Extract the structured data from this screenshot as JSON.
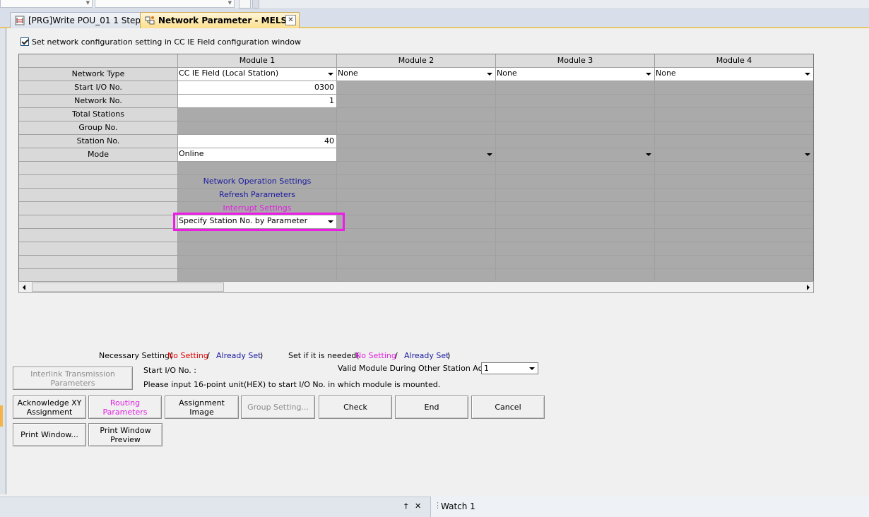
{
  "tabs": [
    {
      "label": "[PRG]Write POU_01 1 Step",
      "active": false
    },
    {
      "label": "Network Parameter - MELS...",
      "active": true
    }
  ],
  "sync_checkbox": {
    "label": "Set network configuration setting in CC IE Field configuration window",
    "checked": true
  },
  "grid": {
    "columns": [
      "Module 1",
      "Module 2",
      "Module 3",
      "Module 4"
    ],
    "row_labels": [
      "Network Type",
      "Start I/O No.",
      "Network No.",
      "Total Stations",
      "Group No.",
      "Station No.",
      "Mode"
    ],
    "network_type": [
      "CC IE Field (Local Station)",
      "None",
      "None",
      "None"
    ],
    "start_io": "0300",
    "network_no": "1",
    "station_no": "40",
    "mode": "Online",
    "links": {
      "network_operation": "Network Operation Settings",
      "refresh": "Refresh Parameters",
      "interrupt": "Interrupt Settings"
    },
    "station_spec": "Specify Station No. by Parameter"
  },
  "legend": {
    "necessary_label": "Necessary Setting(",
    "optional_label": "Set if it is needed(",
    "no_setting": "No Setting",
    "slash": "/",
    "already_set": "Already Set",
    "close_paren": ")"
  },
  "info": {
    "start_io_label": "Start I/O No. :",
    "hint": "Please input 16-point unit(HEX) to start I/O No. in which module is mounted.",
    "valid_module_label": "Valid Module During Other Station Access",
    "valid_module_value": "1"
  },
  "buttons": {
    "interlink": "Interlink Transmission Parameters",
    "ack_xy": "Acknowledge XY Assignment",
    "routing": "Routing Parameters",
    "assignment_image": "Assignment Image",
    "group_setting": "Group Setting...",
    "check": "Check",
    "end": "End",
    "cancel": "Cancel",
    "print_window": "Print Window...",
    "print_preview": "Print Window Preview"
  },
  "bottom": {
    "watch_label": "Watch 1",
    "pin_glyph": "†",
    "close_glyph": "✕"
  },
  "colors": {
    "highlight": "#ee1be9",
    "no_setting_required": "#e00000",
    "already_set": "#1a1aa0",
    "optional": "#e020e0"
  }
}
